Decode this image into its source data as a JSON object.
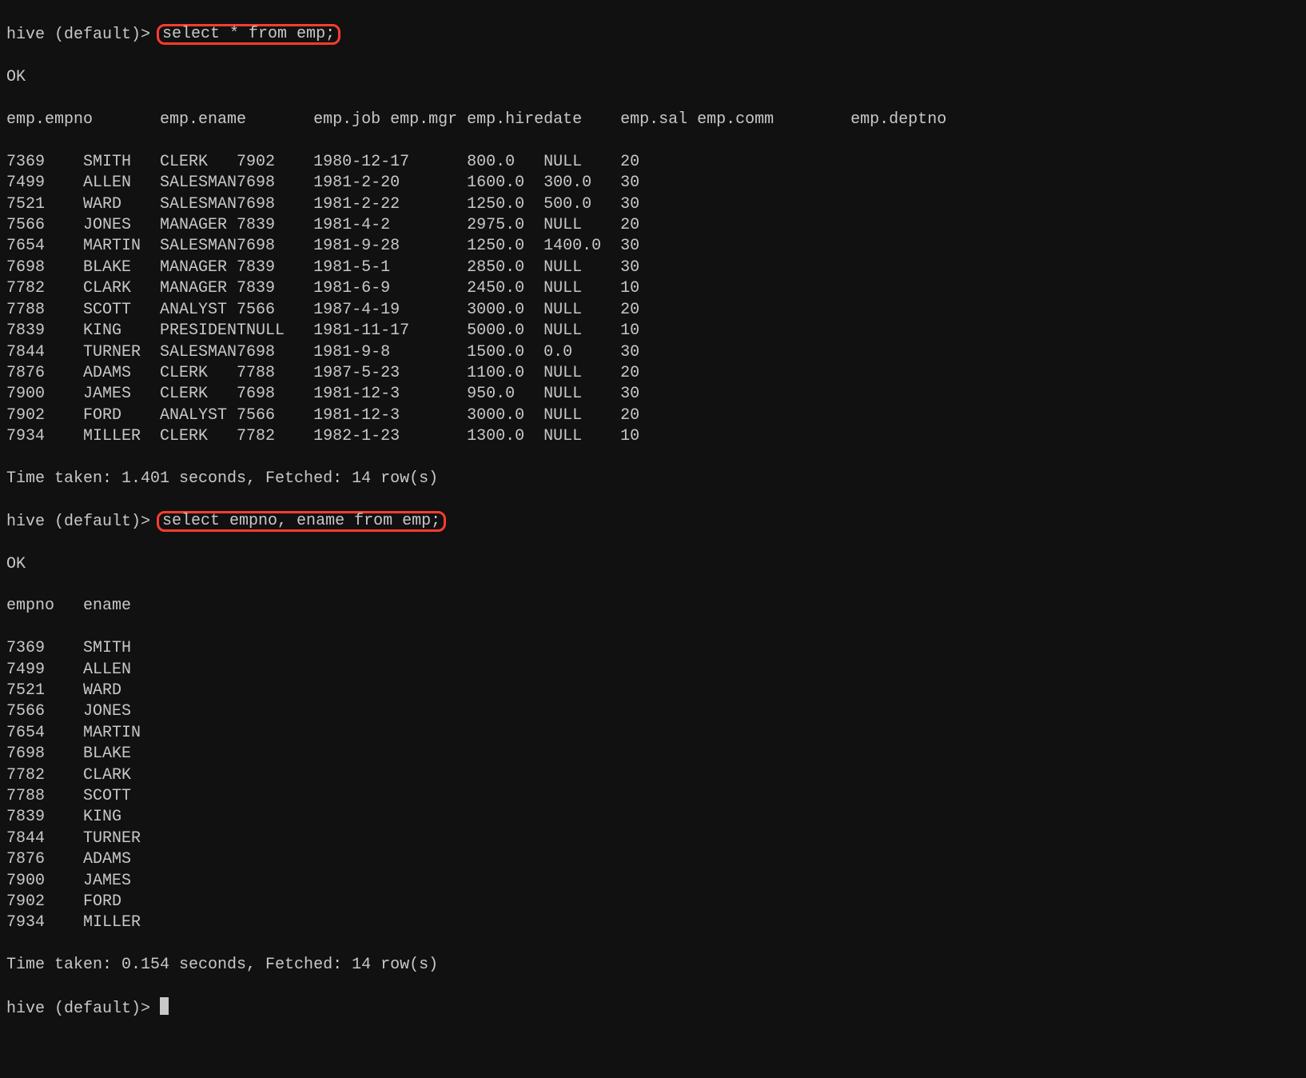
{
  "prompt_label": "hive (default)> ",
  "query1": "select * from emp;",
  "ok": "OK",
  "q1_headers": [
    "emp.empno",
    "emp.ename",
    "emp.job",
    "emp.mgr",
    "emp.hiredate",
    "emp.sal",
    "emp.comm",
    "emp.deptno"
  ],
  "q1_rows": [
    {
      "empno": "7369",
      "ename": "SMITH",
      "job": "CLERK",
      "mgr": "7902",
      "hiredate": "1980-12-17",
      "sal": "800.0",
      "comm": "NULL",
      "deptno": "20"
    },
    {
      "empno": "7499",
      "ename": "ALLEN",
      "job": "SALESMAN",
      "mgr": "7698",
      "hiredate": "1981-2-20",
      "sal": "1600.0",
      "comm": "300.0",
      "deptno": "30"
    },
    {
      "empno": "7521",
      "ename": "WARD",
      "job": "SALESMAN",
      "mgr": "7698",
      "hiredate": "1981-2-22",
      "sal": "1250.0",
      "comm": "500.0",
      "deptno": "30"
    },
    {
      "empno": "7566",
      "ename": "JONES",
      "job": "MANAGER",
      "mgr": "7839",
      "hiredate": "1981-4-2",
      "sal": "2975.0",
      "comm": "NULL",
      "deptno": "20"
    },
    {
      "empno": "7654",
      "ename": "MARTIN",
      "job": "SALESMAN",
      "mgr": "7698",
      "hiredate": "1981-9-28",
      "sal": "1250.0",
      "comm": "1400.0",
      "deptno": "30"
    },
    {
      "empno": "7698",
      "ename": "BLAKE",
      "job": "MANAGER",
      "mgr": "7839",
      "hiredate": "1981-5-1",
      "sal": "2850.0",
      "comm": "NULL",
      "deptno": "30"
    },
    {
      "empno": "7782",
      "ename": "CLARK",
      "job": "MANAGER",
      "mgr": "7839",
      "hiredate": "1981-6-9",
      "sal": "2450.0",
      "comm": "NULL",
      "deptno": "10"
    },
    {
      "empno": "7788",
      "ename": "SCOTT",
      "job": "ANALYST",
      "mgr": "7566",
      "hiredate": "1987-4-19",
      "sal": "3000.0",
      "comm": "NULL",
      "deptno": "20"
    },
    {
      "empno": "7839",
      "ename": "KING",
      "job": "PRESIDENT",
      "mgr": "NULL",
      "hiredate": "1981-11-17",
      "sal": "5000.0",
      "comm": "NULL",
      "deptno": "10"
    },
    {
      "empno": "7844",
      "ename": "TURNER",
      "job": "SALESMAN",
      "mgr": "7698",
      "hiredate": "1981-9-8",
      "sal": "1500.0",
      "comm": "0.0",
      "deptno": "30"
    },
    {
      "empno": "7876",
      "ename": "ADAMS",
      "job": "CLERK",
      "mgr": "7788",
      "hiredate": "1987-5-23",
      "sal": "1100.0",
      "comm": "NULL",
      "deptno": "20"
    },
    {
      "empno": "7900",
      "ename": "JAMES",
      "job": "CLERK",
      "mgr": "7698",
      "hiredate": "1981-12-3",
      "sal": "950.0",
      "comm": "NULL",
      "deptno": "30"
    },
    {
      "empno": "7902",
      "ename": "FORD",
      "job": "ANALYST",
      "mgr": "7566",
      "hiredate": "1981-12-3",
      "sal": "3000.0",
      "comm": "NULL",
      "deptno": "20"
    },
    {
      "empno": "7934",
      "ename": "MILLER",
      "job": "CLERK",
      "mgr": "7782",
      "hiredate": "1982-1-23",
      "sal": "1300.0",
      "comm": "NULL",
      "deptno": "10"
    }
  ],
  "q1_time": "Time taken: 1.401 seconds, Fetched: 14 row(s)",
  "query2": "select empno, ename from emp;",
  "q2_headers": [
    "empno",
    "ename"
  ],
  "q2_rows": [
    {
      "empno": "7369",
      "ename": "SMITH"
    },
    {
      "empno": "7499",
      "ename": "ALLEN"
    },
    {
      "empno": "7521",
      "ename": "WARD"
    },
    {
      "empno": "7566",
      "ename": "JONES"
    },
    {
      "empno": "7654",
      "ename": "MARTIN"
    },
    {
      "empno": "7698",
      "ename": "BLAKE"
    },
    {
      "empno": "7782",
      "ename": "CLARK"
    },
    {
      "empno": "7788",
      "ename": "SCOTT"
    },
    {
      "empno": "7839",
      "ename": "KING"
    },
    {
      "empno": "7844",
      "ename": "TURNER"
    },
    {
      "empno": "7876",
      "ename": "ADAMS"
    },
    {
      "empno": "7900",
      "ename": "JAMES"
    },
    {
      "empno": "7902",
      "ename": "FORD"
    },
    {
      "empno": "7934",
      "ename": "MILLER"
    }
  ],
  "q2_time": "Time taken: 0.154 seconds, Fetched: 14 row(s)",
  "layout": {
    "q1_stops": [
      0,
      8,
      16,
      24,
      32,
      48,
      56,
      64,
      88
    ],
    "q1_header_stops": [
      0,
      16,
      32,
      40,
      48,
      64,
      72,
      88
    ],
    "q2_stops": [
      0,
      8
    ]
  }
}
